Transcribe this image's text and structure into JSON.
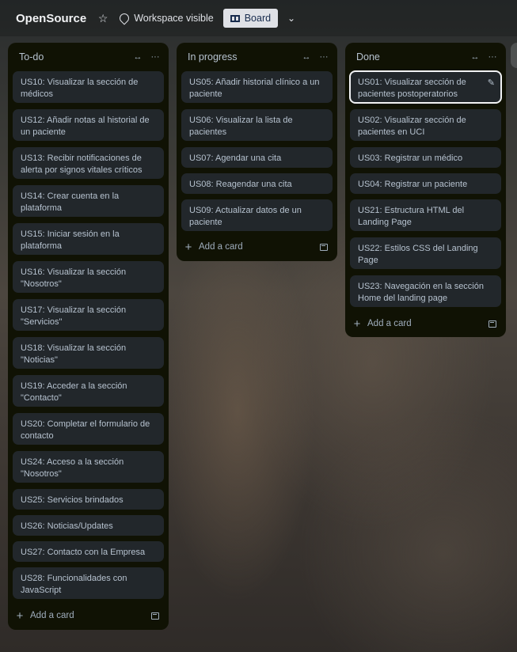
{
  "header": {
    "board_title": "OpenSource",
    "star_icon": "☆",
    "visibility_label": "Workspace visible",
    "view_button_label": "Board",
    "chevron": "⌄"
  },
  "lists": [
    {
      "title": "To-do",
      "cards": [
        "US10: Visualizar la sección de médicos",
        "US12: Añadir notas al historial de un paciente",
        "US13: Recibir notificaciones de alerta por signos vitales críticos",
        "US14: Crear cuenta en la plataforma",
        "US15: Iniciar sesión en la plataforma",
        "US16: Visualizar la sección \"Nosotros\"",
        "US17: Visualizar la sección \"Servicios\"",
        "US18: Visualizar la sección \"Noticias\"",
        "US19: Acceder a la sección \"Contacto\"",
        "US20: Completar el formulario de contacto",
        "US24: Acceso a la sección \"Nosotros\"",
        "US25: Servicios brindados",
        "US26: Noticias/Updates",
        "US27: Contacto con la Empresa",
        "US28: Funcionalidades con JavaScript"
      ],
      "add_card_label": "Add a card"
    },
    {
      "title": "In progress",
      "cards": [
        "US05: Añadir historial clínico a un paciente",
        "US06: Visualizar la lista de pacientes",
        "US07: Agendar una cita",
        "US08: Reagendar una cita",
        "US09: Actualizar datos de un paciente"
      ],
      "add_card_label": "Add a card"
    },
    {
      "title": "Done",
      "cards": [
        "US01: Visualizar sección de pacientes postoperatorios",
        "US02: Visualizar sección de pacientes en UCI",
        "US03: Registrar un médico",
        "US04: Registrar un paciente",
        "US21: Estructura HTML del Landing Page",
        "US22: Estilos CSS del Landing Page",
        "US23: Navegación en la sección Home del landing page"
      ],
      "add_card_label": "Add a card"
    }
  ],
  "icons": {
    "collapse": "↔",
    "more": "···",
    "plus": "+",
    "edit": "✎"
  },
  "colors": {
    "list_bg": "#101204",
    "card_bg": "#22272b",
    "card_text": "#b6c2cf",
    "selected_outline": "#f1f2f4"
  }
}
